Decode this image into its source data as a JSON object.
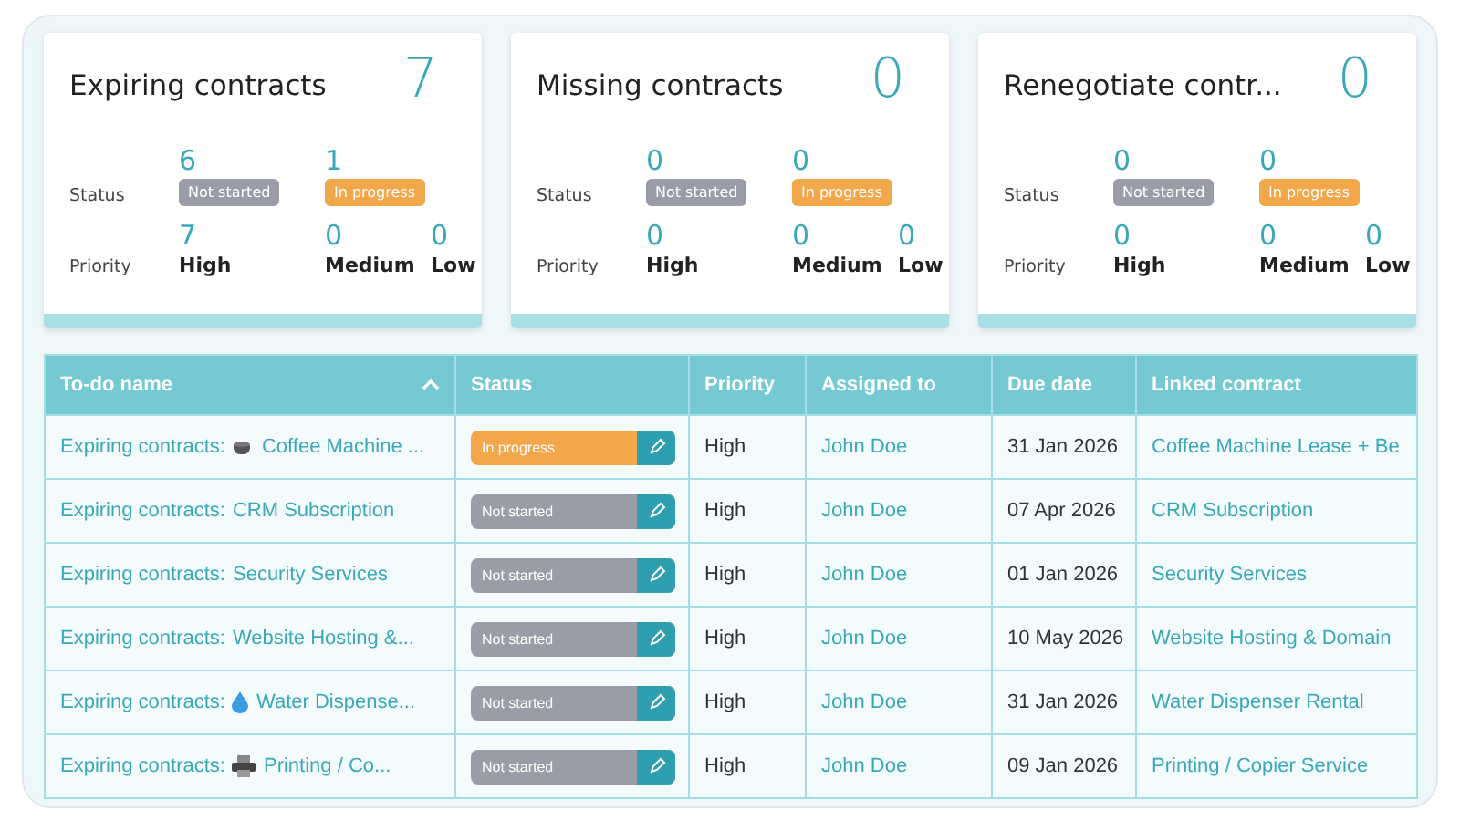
{
  "cards": [
    {
      "title": "Expiring contracts",
      "total": "7",
      "status_label": "Status",
      "statuses": [
        {
          "count": "6",
          "label": "Not started",
          "kind": "not_started"
        },
        {
          "count": "1",
          "label": "In progress",
          "kind": "in_progress"
        }
      ],
      "priority_label": "Priority",
      "priorities": [
        {
          "count": "7",
          "label": "High"
        },
        {
          "count": "0",
          "label": "Medium"
        },
        {
          "count": "0",
          "label": "Low"
        }
      ]
    },
    {
      "title": "Missing contracts",
      "total": "0",
      "status_label": "Status",
      "statuses": [
        {
          "count": "0",
          "label": "Not started",
          "kind": "not_started"
        },
        {
          "count": "0",
          "label": "In progress",
          "kind": "in_progress"
        }
      ],
      "priority_label": "Priority",
      "priorities": [
        {
          "count": "0",
          "label": "High"
        },
        {
          "count": "0",
          "label": "Medium"
        },
        {
          "count": "0",
          "label": "Low"
        }
      ]
    },
    {
      "title": "Renegotiate contr...",
      "total": "0",
      "status_label": "Status",
      "statuses": [
        {
          "count": "0",
          "label": "Not started",
          "kind": "not_started"
        },
        {
          "count": "0",
          "label": "In progress",
          "kind": "in_progress"
        }
      ],
      "priority_label": "Priority",
      "priorities": [
        {
          "count": "0",
          "label": "High"
        },
        {
          "count": "0",
          "label": "Medium"
        },
        {
          "count": "0",
          "label": "Low"
        }
      ]
    }
  ],
  "table": {
    "columns": [
      "To-do name",
      "Status",
      "Priority",
      "Assigned to",
      "Due date",
      "Linked contract"
    ],
    "rows": [
      {
        "todo": {
          "prefix": "Expiring contracts:",
          "kind": "coffee",
          "name": "Coffee Machine ..."
        },
        "status": {
          "label": "In progress",
          "kind": "in_progress"
        },
        "priority": "High",
        "assigned_to": "John Doe",
        "due_date": "31 Jan 2026",
        "linked_contract": "Coffee Machine Lease + Be"
      },
      {
        "todo": {
          "prefix": "Expiring contracts:",
          "name": "CRM Subscription"
        },
        "status": {
          "label": "Not started",
          "kind": "not_started"
        },
        "priority": "High",
        "assigned_to": "John Doe",
        "due_date": "07 Apr 2026",
        "linked_contract": "CRM Subscription"
      },
      {
        "todo": {
          "prefix": "Expiring contracts:",
          "name": "Security Services"
        },
        "status": {
          "label": "Not started",
          "kind": "not_started"
        },
        "priority": "High",
        "assigned_to": "John Doe",
        "due_date": "01 Jan 2026",
        "linked_contract": "Security Services"
      },
      {
        "todo": {
          "prefix": "Expiring contracts:",
          "name": "Website Hosting &..."
        },
        "status": {
          "label": "Not started",
          "kind": "not_started"
        },
        "priority": "High",
        "assigned_to": "John Doe",
        "due_date": "10 May 2026",
        "linked_contract": "Website Hosting & Domain"
      },
      {
        "todo": {
          "prefix": "Expiring contracts:",
          "kind": "water",
          "name": "Water Dispense..."
        },
        "status": {
          "label": "Not started",
          "kind": "not_started"
        },
        "priority": "High",
        "assigned_to": "John Doe",
        "due_date": "31 Jan 2026",
        "linked_contract": "Water Dispenser Rental"
      },
      {
        "todo": {
          "prefix": "Expiring contracts:",
          "kind": "printer",
          "name": "Printing / Co..."
        },
        "status": {
          "label": "Not started",
          "kind": "not_started"
        },
        "priority": "High",
        "assigned_to": "John Doe",
        "due_date": "09 Jan 2026",
        "linked_contract": "Printing / Copier Service"
      }
    ]
  }
}
